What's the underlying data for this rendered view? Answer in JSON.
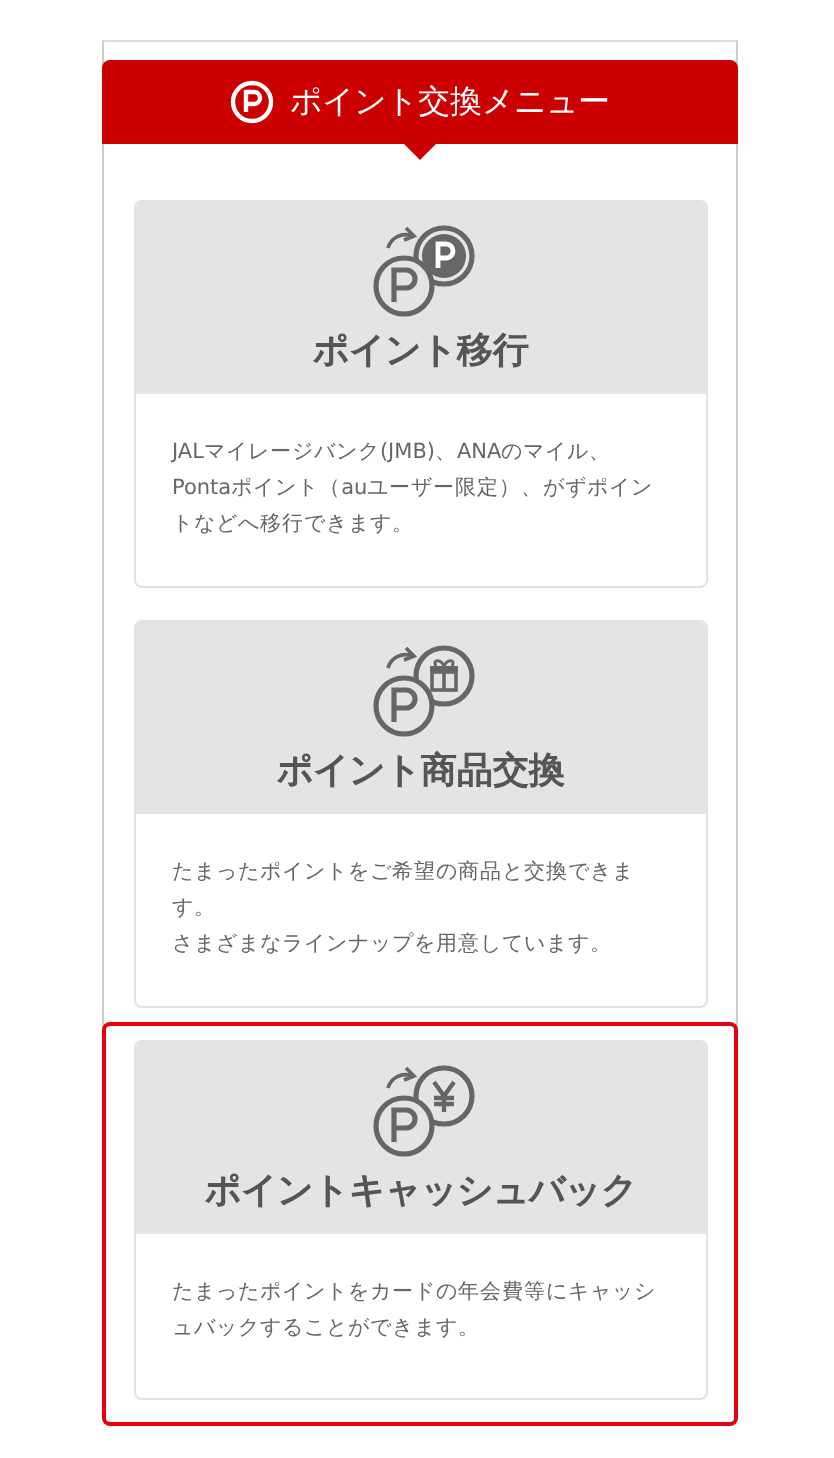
{
  "header": {
    "title": "ポイント交換メニュー"
  },
  "menu": [
    {
      "kind": "points",
      "title": "ポイント移行",
      "description": [
        "JALマイレージバンク(JMB)、ANAのマイル、Pontaポイント（auユーザー限定）、がずポイントなどへ移行できます。"
      ],
      "selected": false
    },
    {
      "kind": "gift",
      "title": "ポイント商品交換",
      "description": [
        "たまったポイントをご希望の商品と交換できます。",
        "さまざまなラインナップを用意しています。"
      ],
      "selected": false
    },
    {
      "kind": "yen",
      "title": "ポイントキャッシュバック",
      "description": [
        "たまったポイントをカードの年会費等にキャッシュバックすることができます。"
      ],
      "selected": true
    }
  ]
}
